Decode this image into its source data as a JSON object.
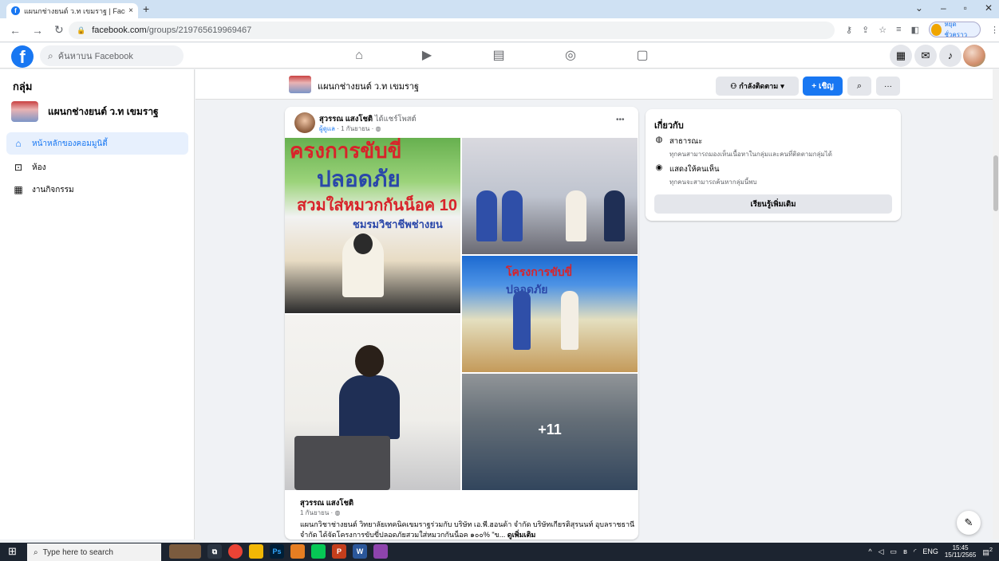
{
  "browser": {
    "tab_title": "แผนกช่างยนต์ ว.ท เขมราฐ | Faceboo",
    "tab_close": "×",
    "new_tab": "+",
    "url_domain": "facebook.com",
    "url_path": "/groups/219765619969467",
    "profile_label": "หยุดชั่วคราว"
  },
  "fb": {
    "search_placeholder": "ค้นหาบน Facebook",
    "logo": "f"
  },
  "sidebar": {
    "heading": "กลุ่ม",
    "group_name": "แผนกช่างยนต์ ว.ท เขมราฐ",
    "items": [
      {
        "label": "หน้าหลักของคอมมูนิตี้"
      },
      {
        "label": "ห้อง"
      },
      {
        "label": "งานกิจกรรม"
      }
    ]
  },
  "group_header": {
    "name": "แผนกช่างยนต์ ว.ท เขมราฐ",
    "follow_label": "กำลังติดตาม",
    "invite_label": "เชิญ"
  },
  "post": {
    "author": "สุวรรณ แสงโชติ",
    "action": "ได้แชร์โพสต์",
    "role": "ผู้ดูแล",
    "date": "1 กันยายน",
    "more_photos": "+11",
    "shared_author": "สุวรรณ แสงโชติ",
    "shared_date": "1 กันยายน",
    "text": "แผนกวิชาช่างยนต์ วิทยาลัยเทคนิคเขมราฐร่วมกับ บริษัท เอ.พี.ฮอนด้า จำกัด บริษัทเกียรติสุรนนท์ อุบลราชธานี จำกัด ได้จัดโครงการขับขี่ปลอดภัยสวมใส่หมวกกันน็อค ๑๐๐% \"ข...",
    "see_more": "ดูเพิ่มเติม",
    "photo1_lines": [
      "ครงการขับขี่",
      "ปลอดภัย",
      "สวมใส่หมวกกันน็อค 10",
      "ชมรมวิชาชีพช่างยน"
    ],
    "photo3_lines": [
      "โครงการขับขี่",
      "ปลอดภัย"
    ]
  },
  "about": {
    "title": "เกี่ยวกับ",
    "public_title": "สาธารณะ",
    "public_desc": "ทุกคนสามารถมองเห็นเนื้อหาในกลุ่มและคนที่ติดตามกลุ่มได้",
    "visible_title": "แสดงให้คนเห็น",
    "visible_desc": "ทุกคนจะสามารถค้นหากลุ่มนี้พบ",
    "learn_more": "เรียนรู้เพิ่มเติม"
  },
  "taskbar": {
    "search_placeholder": "Type here to search",
    "lang": "ENG",
    "time": "15:45",
    "date": "15/11/2565",
    "notif_count": "2"
  },
  "colors": {
    "fb_blue": "#1877f2",
    "page_bg": "#f0f2f5",
    "taskbar": "#1c2430"
  }
}
